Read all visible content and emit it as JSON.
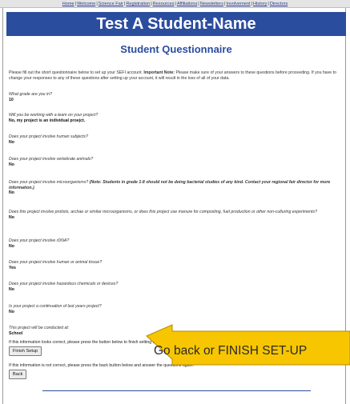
{
  "nav": {
    "items": [
      "Home",
      "Welcome",
      "Science Fair",
      "Registration",
      "Resources",
      "Affiliations",
      "Newsletters",
      "Involvement",
      "History",
      "Directors"
    ]
  },
  "header": {
    "title": "Test A Student-Name"
  },
  "page": {
    "heading": "Student Questionnaire"
  },
  "intro": {
    "text": "Please fill out the short questionnaire below to set up your SEFI account.",
    "important_label": "Important Note:",
    "important_text": "Please make sure of your answers to these questions before proceeding. If you have to change your responses to any of these questions after setting up your account, it will result in the loss of all of your data."
  },
  "questions": [
    {
      "q": "What grade are you in?",
      "a": "10"
    },
    {
      "q": "Will you be working with a team on your project?",
      "a": "No, my project is an individual proejct."
    },
    {
      "q": "Does your project involve human subjects?",
      "a": "No"
    },
    {
      "q": "Does your project involve vertebrate animals?",
      "a": "No"
    },
    {
      "q": "Does your project involve microorganisms?",
      "note": "(Note: Students in grade 1-8 should not be doing bacterial studies of any kind. Contact your regional fair director for more information.)",
      "a": "No"
    },
    {
      "q": "Does this project involve protists, archae or similar microorganisms, or does this project use manure for composting, fuel production or other non-culturing experiments?",
      "a": "No"
    },
    {
      "q": "Does your project involve rDNA?",
      "a": "No"
    },
    {
      "q": "Does your project involve human or animal tissue?",
      "a": "Yes"
    },
    {
      "q": "Does your project involve hazardous chemicals or devices?",
      "a": "No"
    },
    {
      "q": "Is your project a continuation of last years project?",
      "a": "No"
    },
    {
      "q": "This project will be conducted at:",
      "a": "School"
    }
  ],
  "confirm": {
    "correct_text": "If this information looks correct, please press the button below to finish setting up your account.",
    "finish_button": "Finish Setup",
    "incorrect_text": "If this information is not correct, please press the back button below and answer the questions again.",
    "back_button": "Back"
  },
  "annotation": {
    "text": "Go back or FINISH SET-UP",
    "fill_color": "#f7c600",
    "stroke_color": "#b08b00"
  },
  "colors": {
    "title_bar": "#2b4d9e",
    "heading": "#2b4d9e",
    "nav_link": "#2b3a8c"
  }
}
